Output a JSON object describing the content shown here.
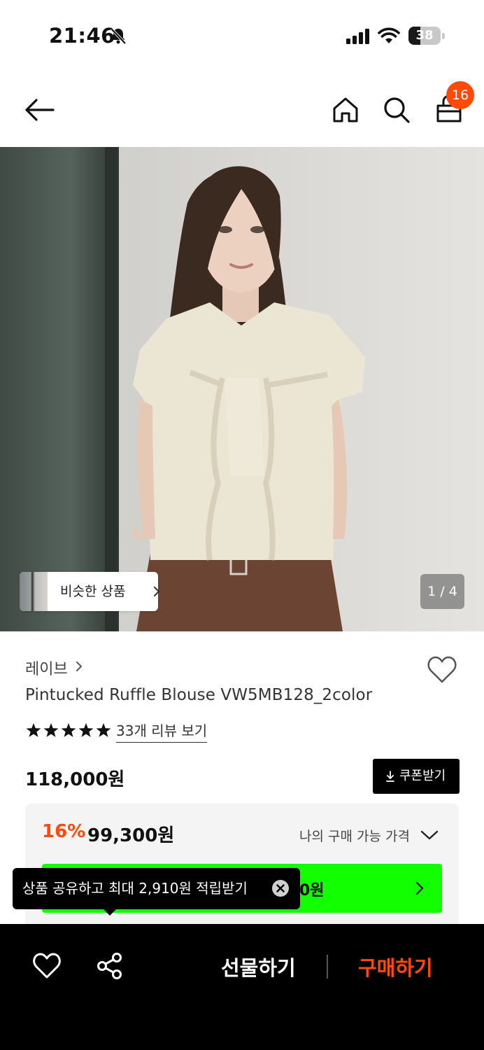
{
  "status_bar": {
    "time": "21:46",
    "battery": "38",
    "battery_level": 0.38
  },
  "header": {
    "cart_count": "16"
  },
  "gallery": {
    "similar_label": "비슷한 상품",
    "page_indicator": "1 / 4"
  },
  "product": {
    "brand": "레이브",
    "title": "Pintucked Ruffle Blouse VW5MB128_2color",
    "rating_stars": 5,
    "review_link": "33개 리뷰 보기",
    "original_price": "118,000원",
    "coupon_label": "쿠폰받기",
    "discount_rate": "16%",
    "discount_price": "99,300원",
    "my_price_label": "나의 구매 가능 가격",
    "banner_partial_text": "0원"
  },
  "tooltip": {
    "text": "상품 공유하고 최대 2,910원 적립받기"
  },
  "bottom_bar": {
    "gift_label": "선물하기",
    "buy_label": "구매하기"
  },
  "colors": {
    "accent": "#ff4a0a",
    "banner": "#11ff00",
    "bottom_bar": "#000000"
  }
}
